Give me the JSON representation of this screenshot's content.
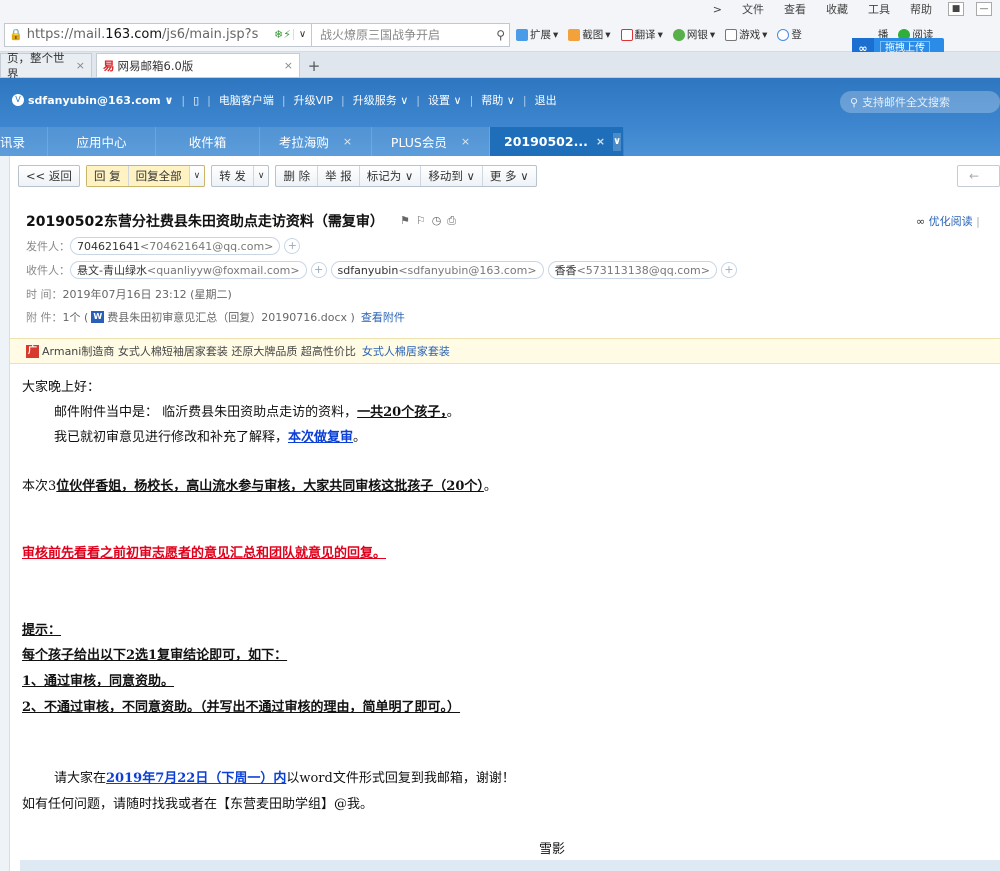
{
  "browser": {
    "menu": [
      "文件",
      "查看",
      "收藏",
      "工具",
      "帮助"
    ],
    "url_prefix": "https://mail.",
    "url_host": "163.com",
    "url_path": "/js6/main.jsp?s",
    "search_text": "战火燎原三国战争开启",
    "tools": [
      "扩展",
      "截图",
      "翻译",
      "网银",
      "游戏",
      "登",
      "播",
      "阅读"
    ],
    "upload_label": "拖拽上传",
    "tabs": [
      {
        "label": "页，整个世界"
      },
      {
        "label": "网易邮箱6.0版"
      }
    ],
    "new_tab": "+"
  },
  "mail_header": {
    "account": "sdfanyubin@163.com ∨",
    "links": [
      "电脑客户端",
      "升级VIP",
      "升级服务 ∨",
      "设置 ∨",
      "帮助 ∨",
      "退出"
    ],
    "search_placeholder": "支持邮件全文搜索",
    "tabs": [
      {
        "label": "讯录",
        "closable": false
      },
      {
        "label": "应用中心",
        "closable": false
      },
      {
        "label": "收件箱",
        "closable": false
      },
      {
        "label": "考拉海购",
        "closable": true
      },
      {
        "label": "PLUS会员",
        "closable": true
      },
      {
        "label": "20190502...",
        "closable": true,
        "active": true
      }
    ]
  },
  "toolbar": {
    "back": "<< 返回",
    "reply": "回 复",
    "reply_all": "回复全部",
    "forward": "转 发",
    "delete": "删 除",
    "report": "举 报",
    "mark_as": "标记为",
    "move_to": "移动到",
    "more": "更 多",
    "nav_prev": "←"
  },
  "message": {
    "subject": "20190502东营分社费县朱田资助点走访资料（需复审）",
    "optimize_read": "优化阅读",
    "from_label": "发件人：",
    "from": {
      "name": "704621641",
      "email": "<704621641@qq.com>"
    },
    "to_label": "收件人：",
    "to": [
      {
        "name": "悬文-青山绿水",
        "email": "<quanliyyw@foxmail.com>"
      },
      {
        "name": "sdfanyubin",
        "email": "<sdfanyubin@163.com>"
      },
      {
        "name": "香香",
        "email": "<573113138@qq.com>"
      }
    ],
    "time_label": "时  间：",
    "time": "2019年07月16日 23:12 (星期二)",
    "attach_label": "附  件：",
    "attach_count": "1个 (",
    "attach_name": "费县朱田初审意见汇总（回复）20190716.docx )",
    "attach_link": "查看附件"
  },
  "ad": {
    "text": "Armani制造商 女式人棉短袖居家套装 还原大牌品质 超高性价比",
    "link": "女式人棉居家套装"
  },
  "body": {
    "greeting": "大家晚上好：",
    "line1_a": "邮件附件当中是： 临沂费县朱田资助点走访的资料，",
    "line1_b": "一共20个孩子，",
    "line1_c": "。",
    "line2_a": "我已就初审意见进行修改和补充了解释，",
    "line2_b": "本次做复审",
    "line2_c": "。",
    "line3_a": "本次3",
    "line3_b": "位伙伴香姐，杨校长，高山流水参与审核，大家共同审核这批孩子（20个）",
    "line3_c": "。",
    "red_line": "审核前先看看之前初审志愿者的意见汇总和团队就意见的回复。",
    "tip": "提示：",
    "tip1": "每个孩子给出以下2选1复审结论即可，如下：",
    "tip2": "1、通过审核，同意资助。",
    "tip3": "2、不通过审核，不同意资助。（并写出不通过审核的理由，简单明了即可。）",
    "deadline_a": "请大家在",
    "deadline_b": "2019年7月22日（下周一）内",
    "deadline_c": "以word文件形式回复到我邮箱，谢谢！",
    "contact": "如有任何问题，请随时找我或者在【东营麦田助学组】@我。",
    "signature": "雪影"
  }
}
